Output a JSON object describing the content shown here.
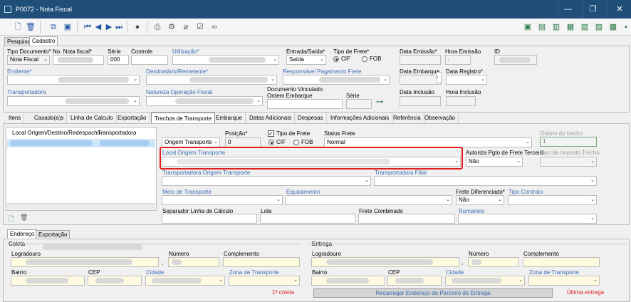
{
  "window": {
    "title": "P0072 - Nota Fiscal",
    "min": "—",
    "restore": "❐",
    "close": "✕"
  },
  "main_tabs": [
    "Pesquisa",
    "Cadastro"
  ],
  "header": {
    "tipo_documento": {
      "label": "Tipo Documento*",
      "value": "Nota Fiscal"
    },
    "numero_nf": {
      "label": "No. Nota fiscal*"
    },
    "serie": {
      "label": "Série",
      "value": "000"
    },
    "controle": {
      "label": "Controle"
    },
    "utilizacao": {
      "label": "Utilização*"
    },
    "entrada_saida": {
      "label": "Entrada/Saída*",
      "value": "Saída"
    },
    "tipo_frete": {
      "label": "Tipo de Frete*",
      "cif": "CIF",
      "fob": "FOB"
    },
    "emissao": {
      "label": "Data Emissão*"
    },
    "hora_emissao": {
      "label": "Hora Emissão",
      "value": ":"
    },
    "id": {
      "label": "ID"
    },
    "emitente": {
      "label": "Emitente*"
    },
    "destinatario": {
      "label": "Destinatário/Remetente*"
    },
    "responsavel": {
      "label": "Responsável Pagamento Frete"
    },
    "embarque": {
      "label": "Data Embarque"
    },
    "registro": {
      "label": "Data Registro*"
    },
    "transportadora": {
      "label": "Transportadora"
    },
    "natureza": {
      "label": "Natureza Operação Fiscal"
    },
    "doc_vinculado": {
      "label": "Documento Vinculado",
      "ordem": "Ordem Embarque",
      "serie": "Série"
    },
    "inclusao": {
      "label": "Data Inclusão"
    },
    "hora_inclusao": {
      "label": "Hora Inclusão"
    }
  },
  "sub_tabs": [
    "Itens",
    "Casado(a)s",
    "Linha de Calculo",
    "Exportação",
    "Trechos de Transporte",
    "Embarque",
    "Datas Adicionais",
    "Despesas",
    "Informações Adicionais",
    "Referência",
    "Observação"
  ],
  "trechos": {
    "col_local": "Local Origem/Destino/Redespacho",
    "col_transp": "Transportadora",
    "tipo_local": "Origem Transporte",
    "posicao": {
      "label": "Posição*",
      "value": "0"
    },
    "tipo_frete": {
      "label": "Tipo de Frete",
      "cif": "CIF",
      "fob": "FOB"
    },
    "status_frete": {
      "label": "Status Frete",
      "value": "Normal"
    },
    "ordem_trecho": {
      "label": "Ordem do trecho",
      "value": "1"
    },
    "local_origem": {
      "label": "Local Origem Transporte"
    },
    "autoriza": {
      "label": "Autoriza Pgto de Frete Terceiro",
      "value": "Não"
    },
    "tipo_imposto": {
      "label": "Tipo de Imposto Trecho"
    },
    "transp_origem": {
      "label": "Transportadora Origem Transporte"
    },
    "transp_filial": {
      "label": "Transportadora Filial"
    },
    "meio": {
      "label": "Meio de Transporte"
    },
    "equipamento": {
      "label": "Equipamento"
    },
    "frete_dif": {
      "label": "Frete Diferenciado*",
      "value": "Não"
    },
    "tipo_contrato": {
      "label": "Tipo Contrato"
    },
    "separador": {
      "label": "Separador Linha de Cálculo"
    },
    "lote": {
      "label": "Lote"
    },
    "frete_combinado": {
      "label": "Frete Combinado"
    },
    "romaneio": {
      "label": "Romaneio"
    }
  },
  "address_tabs": [
    "Endereço",
    "Exportação"
  ],
  "coleta": {
    "title": "Coleta",
    "logradouro": "Logradouro",
    "numero": "Número",
    "complemento": "Complemento",
    "bairro": "Bairro",
    "cep": "CEP",
    "cidade": "Cidade",
    "zona": "Zona de Transporte",
    "note": "1ª coleta",
    "comma": ","
  },
  "entrega": {
    "title": "Entrega",
    "logradouro": "Logradouro",
    "numero": "Número",
    "complemento": "Complemento",
    "bairro": "Bairro",
    "cep": "CEP",
    "cidade": "Cidade",
    "zona": "Zona de Transporte",
    "button": "Recarregar Endereço do Parceiro de Entrega",
    "note": "Última entrega",
    "comma": ","
  },
  "icons": {
    "dropdown": "⌄",
    "key": "⊶",
    "add": "🗋",
    "delete": "🗑"
  }
}
